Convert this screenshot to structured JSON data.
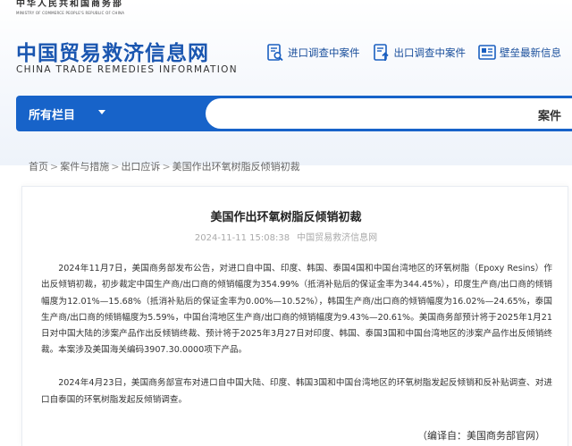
{
  "header": {
    "ministry_cn": "中华人民共和国商务部",
    "ministry_en": "MINISTRY OF COMMERCE PEOPLE'S REPUBLIC OF CHINA",
    "site_title_cn": "中国贸易救济信息网",
    "site_title_en": "CHINA TRADE REMEDIES INFORMATION",
    "quick_links": [
      {
        "label": "进口调查中案件",
        "icon": "magnifier-document-icon"
      },
      {
        "label": "出口调查中案件",
        "icon": "upload-document-icon"
      },
      {
        "label": "壁垒最新信息",
        "icon": "news-board-icon"
      }
    ]
  },
  "nav": {
    "all_columns": "所有栏目",
    "search_select": "案件",
    "search_placeholder": ""
  },
  "breadcrumb": {
    "items": [
      "首页",
      "案件与措施",
      "出口应诉",
      "美国作出环氧树脂反倾销初裁"
    ]
  },
  "article": {
    "title": "美国作出环氧树脂反倾销初裁",
    "date": "2024-11-11 15:08:38",
    "source": "中国贸易救济信息网",
    "paragraphs": [
      "2024年11月7日，美国商务部发布公告，对进口自中国、印度、韩国、泰国4国和中国台湾地区的环氧树脂（Epoxy Resins）作出反倾销初裁，初步裁定中国生产商/出口商的倾销幅度为354.99%（抵消补贴后的保证金率为344.45%），印度生产商/出口商的倾销幅度为12.01%—15.68%（抵消补贴后的保证金率为0.00%—10.52%），韩国生产商/出口商的倾销幅度为16.02%—24.65%，泰国生产商/出口商的倾销幅度为5.59%，中国台湾地区生产商/出口商的倾销幅度为9.43%—20.61%。美国商务部预计将于2025年1月21日对中国大陆的涉案产品作出反倾销终裁、预计将于2025年3月27日对印度、韩国、泰国3国和中国台湾地区的涉案产品作出反倾销终裁。本案涉及美国海关编码3907.30.0000项下产品。",
      "2024年4月23日，美国商务部宣布对进口自中国大陆、印度、韩国3国和中国台湾地区的环氧树脂发起反倾销和反补贴调查、对进口自泰国的环氧树脂发起反倾销调查。"
    ],
    "editor": "（编译自：美国商务部官网）"
  },
  "colors": {
    "brand_blue": "#1a56b0",
    "nav_blue": "#1763c9"
  }
}
